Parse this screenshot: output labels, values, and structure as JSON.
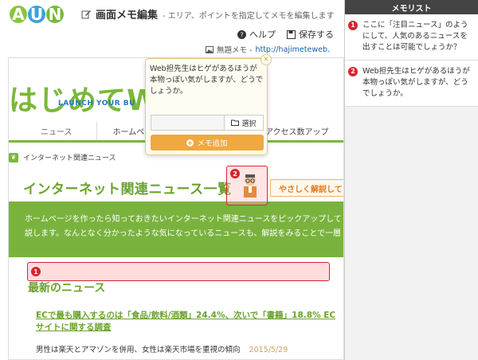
{
  "header": {
    "logo": [
      "A",
      "U",
      "N"
    ],
    "title": "画面メモ編集",
    "subtitle": "- エリア、ポイントを指定してメモを編集します",
    "help": "ヘルプ",
    "save": "保存する",
    "memo_name": "無題メモ - ",
    "url": "http://hajimeteweb."
  },
  "site": {
    "logo": "はじめてWE",
    "tagline": "LAUNCH YOUR BU",
    "nav": [
      "ニュース",
      "ホームページ",
      "アクセス数アップ"
    ],
    "breadcrumb": "インターネット関連ニュース",
    "heading": "インターネット関連ニュース一覧",
    "badge": "やさしく解説して",
    "intro_line1": "ホームページを作ったら知っておきたいインターネット関連ニュースをピックアップして",
    "intro_line2": "説します。なんとなく分かったような気になっているニュースも、解説をみることで一層",
    "latest": "最新のニュース",
    "news_title": "ECで最も購入するのは「食品/飲料/酒類」24.4%、次いで「書籍」18.8% ECサイトに関する調査",
    "news_sub": "男性は楽天とアマゾンを併用、女性は楽天市場を重視の傾向",
    "news_date": "2015/5/29"
  },
  "popup": {
    "text": "Web担先生はヒゲがあるほうが本物っぽい気がしますが、どうでしょうか。",
    "select": "選択",
    "add": "メモ追加"
  },
  "markers": [
    "1",
    "2"
  ],
  "panel": {
    "title": "メモリスト",
    "memos": [
      {
        "num": "1",
        "text": "ここに「注目ニュース」のようにして、人気のあるニュースを出すことは可能でしょうか？"
      },
      {
        "num": "2",
        "text": "Web担先生はヒゲがあるほうが本物っぽい気がしますが、どうでしょうか。"
      }
    ]
  },
  "colors": {
    "accent_green": "#7ab83a",
    "marker_red": "#d9232d",
    "button_orange": "#f0a840"
  }
}
